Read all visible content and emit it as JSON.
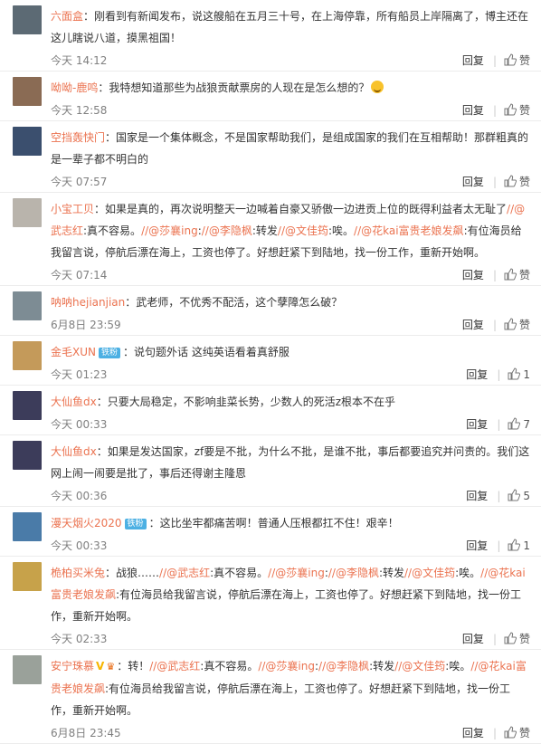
{
  "ui": {
    "reply_label": "回复",
    "like_label": "赞"
  },
  "comments": [
    {
      "user": "六面盒",
      "segments": [
        {
          "t": "text",
          "v": "：刚看到有新闻发布，说这艘船在五月三十号，在上海停靠，所有船员上岸隔离了，博主还在这儿瞎说八道，摸黑祖国！"
        }
      ],
      "time": "今天 14:12",
      "likes": "赞"
    },
    {
      "user": "呦呦-鹿鸣",
      "segments": [
        {
          "t": "text",
          "v": "：我特想知道那些为战狼贡献票房的人现在是怎么想的？"
        }
      ],
      "time": "今天 12:58",
      "likes": "赞",
      "emoji": "thinking-face-emoji"
    },
    {
      "user": "空挡轰快门",
      "segments": [
        {
          "t": "text",
          "v": "：国家是一个集体概念，不是国家帮助我们，是组成国家的我们在互相帮助！那群粗真的是一辈子都不明白的"
        }
      ],
      "time": "今天 07:57",
      "likes": "赞"
    },
    {
      "user": "小宝工贝",
      "segments": [
        {
          "t": "text",
          "v": "：如果是真的，再次说明整天一边喊着自豪又骄傲一边进贡上位的既得利益者太无耻了"
        },
        {
          "t": "mention",
          "v": "//@武志红"
        },
        {
          "t": "text",
          "v": ":真不容易。"
        },
        {
          "t": "mention",
          "v": "//@莎襄ing"
        },
        {
          "t": "text",
          "v": ":"
        },
        {
          "t": "mention",
          "v": "//@李隐枫"
        },
        {
          "t": "text",
          "v": ":转发"
        },
        {
          "t": "mention",
          "v": "//@文佳筠"
        },
        {
          "t": "text",
          "v": ":唉。"
        },
        {
          "t": "mention",
          "v": "//@花kai富贵老娘发飙"
        },
        {
          "t": "text",
          "v": ":有位海员给我留言说，停航后漂在海上，工资也停了。好想赶紧下到陆地，找一份工作，重新开始啊。"
        }
      ],
      "time": "今天 07:14",
      "likes": "赞"
    },
    {
      "user": "呐呐hejianjian",
      "segments": [
        {
          "t": "text",
          "v": "：武老师，不优秀不配活，这个孽障怎么破？"
        }
      ],
      "time": "6月8日 23:59",
      "likes": "赞"
    },
    {
      "user": "金毛XUN",
      "badge": "铁粉",
      "segments": [
        {
          "t": "text",
          "v": "：说句题外话 这纯英语看着真舒服"
        }
      ],
      "time": "今天 01:23",
      "likes": "1"
    },
    {
      "user": "大仙鱼dx",
      "segments": [
        {
          "t": "text",
          "v": "：只要大局稳定，不影响韭菜长势，少数人的死活z根本不在乎"
        }
      ],
      "time": "今天 00:33",
      "likes": "7"
    },
    {
      "user": "大仙鱼dx",
      "segments": [
        {
          "t": "text",
          "v": "：如果是发达国家，zf要是不批，为什么不批，是谁不批，事后都要追究并问责的。我们这网上闹一闹要是批了，事后还得谢主隆恩"
        }
      ],
      "time": "今天 00:36",
      "likes": "5"
    },
    {
      "user": "漫天烟火2020",
      "badge": "铁粉",
      "segments": [
        {
          "t": "text",
          "v": "：这比坐牢都痛苦啊！普通人压根都扛不住！艰辛！"
        }
      ],
      "time": "今天 00:33",
      "likes": "1"
    },
    {
      "user": "桅柏买米兔",
      "segments": [
        {
          "t": "text",
          "v": "：战狼……"
        },
        {
          "t": "mention",
          "v": "//@武志红"
        },
        {
          "t": "text",
          "v": ":真不容易。"
        },
        {
          "t": "mention",
          "v": "//@莎襄ing"
        },
        {
          "t": "text",
          "v": ":"
        },
        {
          "t": "mention",
          "v": "//@李隐枫"
        },
        {
          "t": "text",
          "v": ":转发"
        },
        {
          "t": "mention",
          "v": "//@文佳筠"
        },
        {
          "t": "text",
          "v": ":唉。"
        },
        {
          "t": "mention",
          "v": "//@花kai富贵老娘发飙"
        },
        {
          "t": "text",
          "v": ":有位海员给我留言说，停航后漂在海上，工资也停了。好想赶紧下到陆地，找一份工作，重新开始啊。"
        }
      ],
      "time": "今天 02:33",
      "likes": "赞"
    },
    {
      "user": "安宁珠慕",
      "vip": "V",
      "segments": [
        {
          "t": "text",
          "v": "：转！"
        },
        {
          "t": "mention",
          "v": "//@武志红"
        },
        {
          "t": "text",
          "v": ":真不容易。"
        },
        {
          "t": "mention",
          "v": "//@莎襄ing"
        },
        {
          "t": "text",
          "v": ":"
        },
        {
          "t": "mention",
          "v": "//@李隐枫"
        },
        {
          "t": "text",
          "v": ":转发"
        },
        {
          "t": "mention",
          "v": "//@文佳筠"
        },
        {
          "t": "text",
          "v": ":唉。"
        },
        {
          "t": "mention",
          "v": "//@花kai富贵老娘发飙"
        },
        {
          "t": "text",
          "v": ":有位海员给我留言说，停航后漂在海上，工资也停了。好想赶紧下到陆地，找一份工作，重新开始啊。"
        }
      ],
      "time": "6月8日 23:45",
      "likes": "赞"
    }
  ],
  "avatar_colors": [
    "#5c6a74",
    "#8a6b54",
    "#3b4f6e",
    "#b9b4ac",
    "#7d8c94",
    "#c49a5a",
    "#3c3c5a",
    "#3c3c5a",
    "#4a7ba8",
    "#c7a24a",
    "#9aa19a"
  ]
}
